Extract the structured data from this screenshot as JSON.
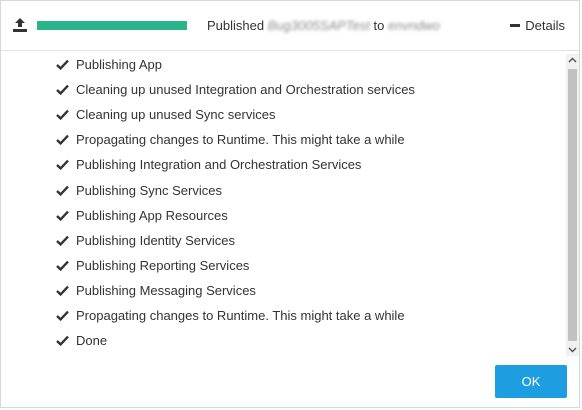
{
  "header": {
    "progress": 1.0,
    "status_prefix": "Published",
    "app_name": "Bug3005SAPTest",
    "status_mid": "to",
    "target_env": "envndwo",
    "details_label": "Details"
  },
  "log": {
    "items": [
      "Publishing App",
      "Cleaning up unused Integration and Orchestration services",
      "Cleaning up unused Sync services",
      "Propagating changes to Runtime. This might take a while",
      "Publishing Integration and Orchestration Services",
      "Publishing Sync Services",
      "Publishing App Resources",
      "Publishing Identity Services",
      "Publishing Reporting Services",
      "Publishing Messaging Services",
      "Propagating changes to Runtime. This might take a while",
      "Done"
    ]
  },
  "footer": {
    "ok_label": "OK"
  },
  "colors": {
    "progress": "#2bb38e",
    "button": "#1e9de0",
    "text": "#333333"
  },
  "icons": {
    "upload": "upload-icon",
    "check": "check-icon",
    "collapse": "minus-icon"
  }
}
